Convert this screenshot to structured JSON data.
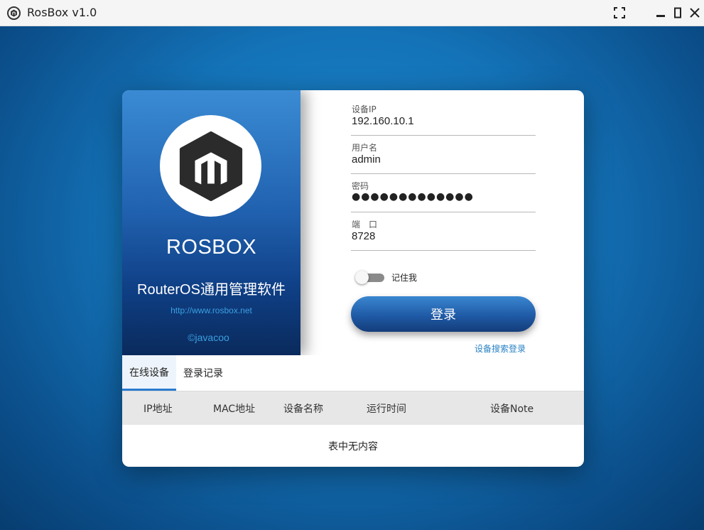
{
  "window": {
    "title": "RosBox v1.0"
  },
  "brand": {
    "title": "ROSBOX",
    "subtitle": "RouterOS通用管理软件",
    "link": "http://www.rosbox.net",
    "author": "©javacoo"
  },
  "form": {
    "ip": {
      "label": "设备IP",
      "value": "192.160.10.1"
    },
    "username": {
      "label": "用户名",
      "value": "admin"
    },
    "password": {
      "label": "密码",
      "value": "●●●●●●●●●●●●●"
    },
    "port": {
      "label": "端　口",
      "value": "8728"
    },
    "remember": {
      "label": "记住我",
      "checked": false
    },
    "login_button": "登录",
    "search_login": "设备搜索登录"
  },
  "tabs": [
    {
      "label": "在线设备",
      "active": true
    },
    {
      "label": "登录记录",
      "active": false
    }
  ],
  "table": {
    "columns": [
      "IP地址",
      "MAC地址",
      "设备名称",
      "运行时间",
      "设备Note"
    ],
    "empty_text": "表中无内容"
  },
  "icons": {
    "app": "rosbox-logo-icon",
    "maximize": "fullscreen-icon",
    "minimize": "minimize-icon",
    "restore": "restore-icon",
    "close": "close-icon"
  },
  "colors": {
    "accent": "#2a7bd0",
    "brand_panel_top": "#3a8bd4",
    "brand_panel_bottom": "#0a2a5c",
    "link": "#2a82c4"
  }
}
